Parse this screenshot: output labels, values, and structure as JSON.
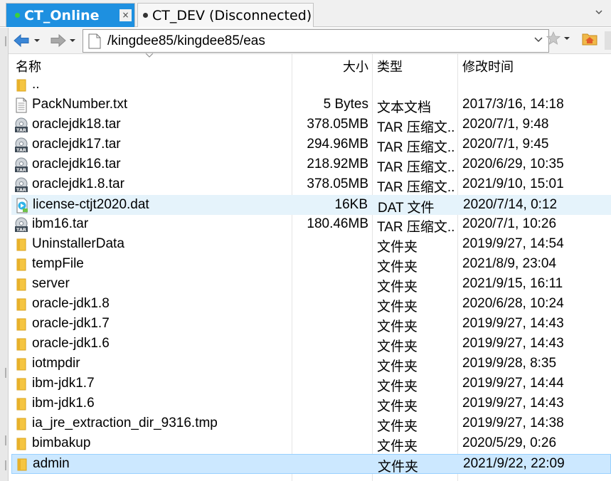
{
  "tabs": [
    {
      "label": "CT_Online",
      "status": "connected",
      "active": true,
      "close_glyph": "×"
    },
    {
      "label": "CT_DEV (Disconnected)",
      "status": "disconnected",
      "active": false
    }
  ],
  "toolbar": {
    "path": "/kingdee85/kingdee85/eas",
    "back_icon": "arrow-left-icon",
    "forward_icon": "arrow-right-icon",
    "bookmark_icon": "star-icon",
    "home_icon": "home-folder-icon"
  },
  "columns": {
    "name": "名称",
    "size": "大小",
    "type": "类型",
    "modified": "修改时间"
  },
  "files": [
    {
      "name": "..",
      "size": "",
      "type": "",
      "modified": "",
      "icon": "folder",
      "state": ""
    },
    {
      "name": "PackNumber.txt",
      "size": "5 Bytes",
      "type": "文本文档",
      "modified": "2017/3/16, 14:18",
      "icon": "text",
      "state": ""
    },
    {
      "name": "oraclejdk18.tar",
      "size": "378.05MB",
      "type": "TAR 压缩文...",
      "modified": "2020/7/1, 9:48",
      "icon": "tar",
      "state": ""
    },
    {
      "name": "oraclejdk17.tar",
      "size": "294.96MB",
      "type": "TAR 压缩文...",
      "modified": "2020/7/1, 9:45",
      "icon": "tar",
      "state": ""
    },
    {
      "name": "oraclejdk16.tar",
      "size": "218.92MB",
      "type": "TAR 压缩文...",
      "modified": "2020/6/29, 10:35",
      "icon": "tar",
      "state": ""
    },
    {
      "name": "oraclejdk1.8.tar",
      "size": "378.05MB",
      "type": "TAR 压缩文...",
      "modified": "2021/9/10, 15:01",
      "icon": "tar",
      "state": ""
    },
    {
      "name": "license-ctjt2020.dat",
      "size": "16KB",
      "type": "DAT 文件",
      "modified": "2020/7/14, 0:12",
      "icon": "dat",
      "state": "hover"
    },
    {
      "name": "ibm16.tar",
      "size": "180.46MB",
      "type": "TAR 压缩文...",
      "modified": "2020/7/1, 10:26",
      "icon": "tar",
      "state": ""
    },
    {
      "name": "UninstallerData",
      "size": "",
      "type": "文件夹",
      "modified": "2019/9/27, 14:54",
      "icon": "folder",
      "state": ""
    },
    {
      "name": "tempFile",
      "size": "",
      "type": "文件夹",
      "modified": "2021/8/9, 23:04",
      "icon": "folder",
      "state": ""
    },
    {
      "name": "server",
      "size": "",
      "type": "文件夹",
      "modified": "2021/9/15, 16:11",
      "icon": "folder",
      "state": ""
    },
    {
      "name": "oracle-jdk1.8",
      "size": "",
      "type": "文件夹",
      "modified": "2020/6/28, 10:24",
      "icon": "folder",
      "state": ""
    },
    {
      "name": "oracle-jdk1.7",
      "size": "",
      "type": "文件夹",
      "modified": "2019/9/27, 14:43",
      "icon": "folder",
      "state": ""
    },
    {
      "name": "oracle-jdk1.6",
      "size": "",
      "type": "文件夹",
      "modified": "2019/9/27, 14:43",
      "icon": "folder",
      "state": ""
    },
    {
      "name": "iotmpdir",
      "size": "",
      "type": "文件夹",
      "modified": "2019/9/28, 8:35",
      "icon": "folder",
      "state": ""
    },
    {
      "name": "ibm-jdk1.7",
      "size": "",
      "type": "文件夹",
      "modified": "2019/9/27, 14:44",
      "icon": "folder",
      "state": ""
    },
    {
      "name": "ibm-jdk1.6",
      "size": "",
      "type": "文件夹",
      "modified": "2019/9/27, 14:43",
      "icon": "folder",
      "state": ""
    },
    {
      "name": "ia_jre_extraction_dir_9316.tmp",
      "size": "",
      "type": "文件夹",
      "modified": "2019/9/27, 14:38",
      "icon": "folder",
      "state": ""
    },
    {
      "name": "bimbakup",
      "size": "",
      "type": "文件夹",
      "modified": "2020/5/29, 0:26",
      "icon": "folder",
      "state": ""
    },
    {
      "name": "admin",
      "size": "",
      "type": "文件夹",
      "modified": "2021/9/22, 22:09",
      "icon": "folder",
      "state": "selected"
    }
  ],
  "colors": {
    "active_tab": "#1e90e0",
    "selection": "#cce8ff",
    "hover": "#e5f3fb",
    "folder": "#f5c542"
  }
}
